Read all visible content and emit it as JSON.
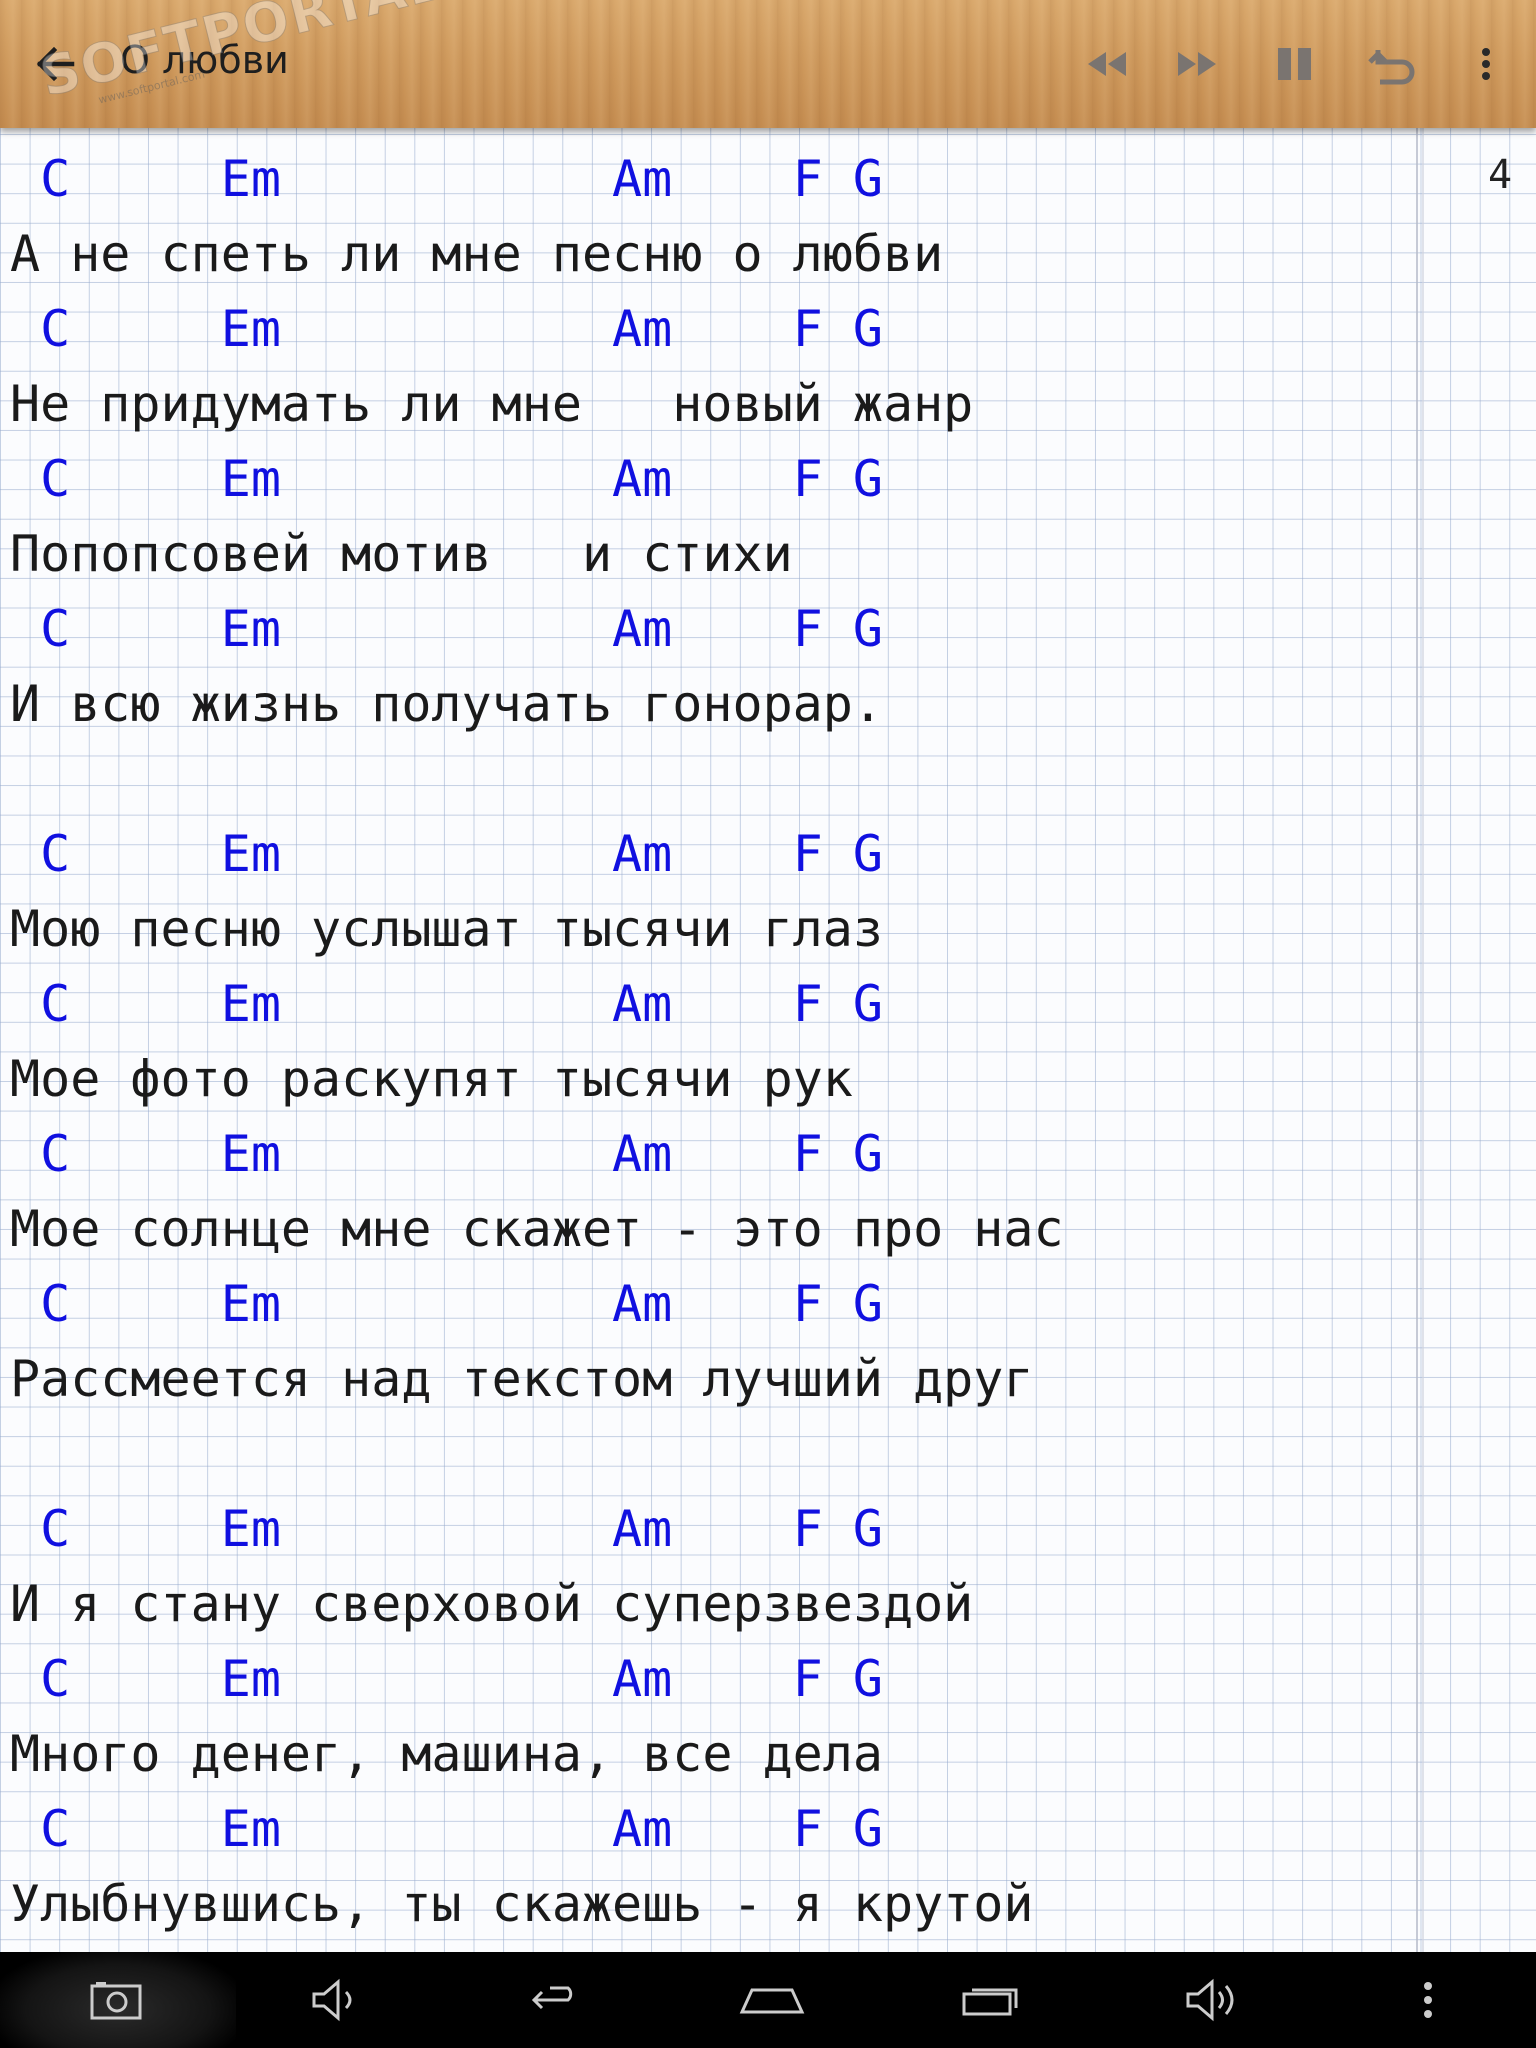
{
  "app": {
    "title": "О любви",
    "watermark": "SOFTPORTAL",
    "watermark_url": "www.softportal.com"
  },
  "toolbar": {
    "back_icon": "arrow-left-icon",
    "rewind_icon": "rewind-icon",
    "fast_forward_icon": "fast-forward-icon",
    "pause_icon": "pause-icon",
    "undo_icon": "undo-icon",
    "overflow_icon": "more-vert-icon"
  },
  "page_number": "4",
  "song": {
    "lines": [
      {
        "type": "chords",
        "text": " C     Em           Am    F G"
      },
      {
        "type": "lyric",
        "text": "А не спеть ли мне песню о любви"
      },
      {
        "type": "chords",
        "text": " C     Em           Am    F G"
      },
      {
        "type": "lyric",
        "text": "Не придумать ли мне   новый жанр"
      },
      {
        "type": "chords",
        "text": " C     Em           Am    F G"
      },
      {
        "type": "lyric",
        "text": "Попопсовей мотив   и стихи"
      },
      {
        "type": "chords",
        "text": " C     Em           Am    F G"
      },
      {
        "type": "lyric",
        "text": "И всю жизнь получать гонорар."
      },
      {
        "type": "blank",
        "text": ""
      },
      {
        "type": "chords",
        "text": " C     Em           Am    F G"
      },
      {
        "type": "lyric",
        "text": "Мою песню услышат тысячи глаз"
      },
      {
        "type": "chords",
        "text": " C     Em           Am    F G"
      },
      {
        "type": "lyric",
        "text": "Мое фото раскупят тысячи рук"
      },
      {
        "type": "chords",
        "text": " C     Em           Am    F G"
      },
      {
        "type": "lyric",
        "text": "Мое солнце мне скажет - это про нас"
      },
      {
        "type": "chords",
        "text": " C     Em           Am    F G"
      },
      {
        "type": "lyric",
        "text": "Рассмеется над текстом лучший друг"
      },
      {
        "type": "blank",
        "text": ""
      },
      {
        "type": "chords",
        "text": " C     Em           Am    F G"
      },
      {
        "type": "lyric",
        "text": "И я стану сверховой суперзвездой"
      },
      {
        "type": "chords",
        "text": " C     Em           Am    F G"
      },
      {
        "type": "lyric",
        "text": "Много денег, машина, все дела"
      },
      {
        "type": "chords",
        "text": " C     Em           Am    F G"
      },
      {
        "type": "lyric",
        "text": "Улыбнувшись, ты скажешь - я крутой"
      }
    ]
  },
  "navbar": {
    "screenshot_icon": "camera-icon",
    "volume_down_icon": "volume-down-icon",
    "back_icon": "nav-back-icon",
    "home_icon": "nav-home-icon",
    "recents_icon": "nav-recents-icon",
    "volume_up_icon": "volume-up-icon",
    "menu_icon": "nav-more-icon"
  },
  "colors": {
    "chord": "#1010e0",
    "lyric": "#1a1a1a",
    "wood": "#cf9a5d"
  }
}
